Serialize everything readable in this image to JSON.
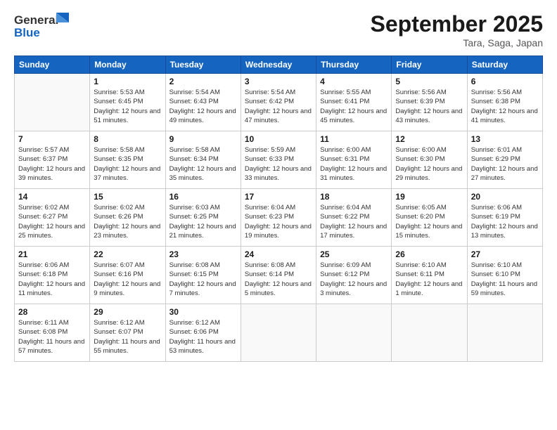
{
  "header": {
    "logo_line1": "General",
    "logo_line2": "Blue",
    "month_title": "September 2025",
    "location": "Tara, Saga, Japan"
  },
  "days_of_week": [
    "Sunday",
    "Monday",
    "Tuesday",
    "Wednesday",
    "Thursday",
    "Friday",
    "Saturday"
  ],
  "weeks": [
    [
      {
        "day": "",
        "empty": true
      },
      {
        "day": "1",
        "sunrise": "5:53 AM",
        "sunset": "6:45 PM",
        "daylight": "12 hours and 51 minutes."
      },
      {
        "day": "2",
        "sunrise": "5:54 AM",
        "sunset": "6:43 PM",
        "daylight": "12 hours and 49 minutes."
      },
      {
        "day": "3",
        "sunrise": "5:54 AM",
        "sunset": "6:42 PM",
        "daylight": "12 hours and 47 minutes."
      },
      {
        "day": "4",
        "sunrise": "5:55 AM",
        "sunset": "6:41 PM",
        "daylight": "12 hours and 45 minutes."
      },
      {
        "day": "5",
        "sunrise": "5:56 AM",
        "sunset": "6:39 PM",
        "daylight": "12 hours and 43 minutes."
      },
      {
        "day": "6",
        "sunrise": "5:56 AM",
        "sunset": "6:38 PM",
        "daylight": "12 hours and 41 minutes."
      }
    ],
    [
      {
        "day": "7",
        "sunrise": "5:57 AM",
        "sunset": "6:37 PM",
        "daylight": "12 hours and 39 minutes."
      },
      {
        "day": "8",
        "sunrise": "5:58 AM",
        "sunset": "6:35 PM",
        "daylight": "12 hours and 37 minutes."
      },
      {
        "day": "9",
        "sunrise": "5:58 AM",
        "sunset": "6:34 PM",
        "daylight": "12 hours and 35 minutes."
      },
      {
        "day": "10",
        "sunrise": "5:59 AM",
        "sunset": "6:33 PM",
        "daylight": "12 hours and 33 minutes."
      },
      {
        "day": "11",
        "sunrise": "6:00 AM",
        "sunset": "6:31 PM",
        "daylight": "12 hours and 31 minutes."
      },
      {
        "day": "12",
        "sunrise": "6:00 AM",
        "sunset": "6:30 PM",
        "daylight": "12 hours and 29 minutes."
      },
      {
        "day": "13",
        "sunrise": "6:01 AM",
        "sunset": "6:29 PM",
        "daylight": "12 hours and 27 minutes."
      }
    ],
    [
      {
        "day": "14",
        "sunrise": "6:02 AM",
        "sunset": "6:27 PM",
        "daylight": "12 hours and 25 minutes."
      },
      {
        "day": "15",
        "sunrise": "6:02 AM",
        "sunset": "6:26 PM",
        "daylight": "12 hours and 23 minutes."
      },
      {
        "day": "16",
        "sunrise": "6:03 AM",
        "sunset": "6:25 PM",
        "daylight": "12 hours and 21 minutes."
      },
      {
        "day": "17",
        "sunrise": "6:04 AM",
        "sunset": "6:23 PM",
        "daylight": "12 hours and 19 minutes."
      },
      {
        "day": "18",
        "sunrise": "6:04 AM",
        "sunset": "6:22 PM",
        "daylight": "12 hours and 17 minutes."
      },
      {
        "day": "19",
        "sunrise": "6:05 AM",
        "sunset": "6:20 PM",
        "daylight": "12 hours and 15 minutes."
      },
      {
        "day": "20",
        "sunrise": "6:06 AM",
        "sunset": "6:19 PM",
        "daylight": "12 hours and 13 minutes."
      }
    ],
    [
      {
        "day": "21",
        "sunrise": "6:06 AM",
        "sunset": "6:18 PM",
        "daylight": "12 hours and 11 minutes."
      },
      {
        "day": "22",
        "sunrise": "6:07 AM",
        "sunset": "6:16 PM",
        "daylight": "12 hours and 9 minutes."
      },
      {
        "day": "23",
        "sunrise": "6:08 AM",
        "sunset": "6:15 PM",
        "daylight": "12 hours and 7 minutes."
      },
      {
        "day": "24",
        "sunrise": "6:08 AM",
        "sunset": "6:14 PM",
        "daylight": "12 hours and 5 minutes."
      },
      {
        "day": "25",
        "sunrise": "6:09 AM",
        "sunset": "6:12 PM",
        "daylight": "12 hours and 3 minutes."
      },
      {
        "day": "26",
        "sunrise": "6:10 AM",
        "sunset": "6:11 PM",
        "daylight": "12 hours and 1 minute."
      },
      {
        "day": "27",
        "sunrise": "6:10 AM",
        "sunset": "6:10 PM",
        "daylight": "11 hours and 59 minutes."
      }
    ],
    [
      {
        "day": "28",
        "sunrise": "6:11 AM",
        "sunset": "6:08 PM",
        "daylight": "11 hours and 57 minutes."
      },
      {
        "day": "29",
        "sunrise": "6:12 AM",
        "sunset": "6:07 PM",
        "daylight": "11 hours and 55 minutes."
      },
      {
        "day": "30",
        "sunrise": "6:12 AM",
        "sunset": "6:06 PM",
        "daylight": "11 hours and 53 minutes."
      },
      {
        "day": "",
        "empty": true
      },
      {
        "day": "",
        "empty": true
      },
      {
        "day": "",
        "empty": true
      },
      {
        "day": "",
        "empty": true
      }
    ]
  ]
}
